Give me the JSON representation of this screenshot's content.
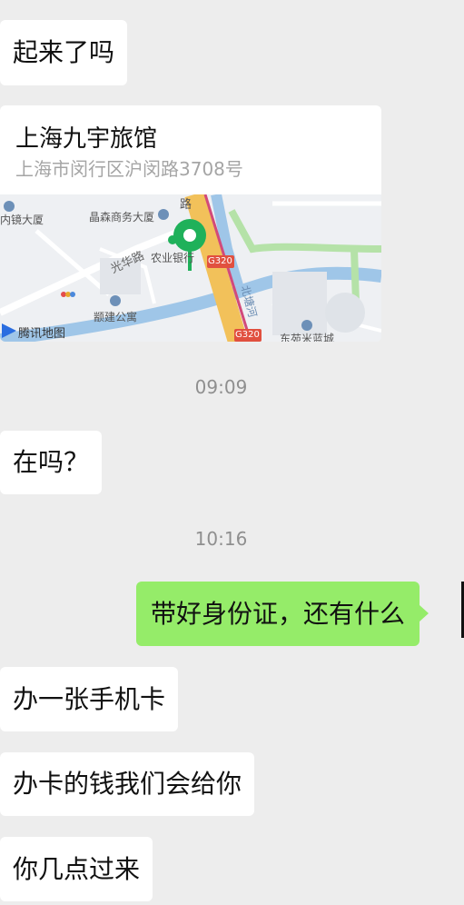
{
  "messages": {
    "m1": "起来了吗",
    "location": {
      "name": "上海九宇旅馆",
      "address": "上海市闵行区沪闵路3708号",
      "map_labels": {
        "neimeng": "内镜大厦",
        "jingsen": "晶森商务大厦",
        "bank": "农业银行",
        "road1": "光华路",
        "apt": "颛建公寓",
        "road2": "路",
        "g320a": "G320",
        "g320b": "G320",
        "river_road": "北塘河",
        "east": "东苑米蓝城",
        "brand": "腾讯地图"
      }
    },
    "time1": "09:09",
    "m2": "在吗？",
    "time2": "10:16",
    "m3": "带好身份证，还有什么",
    "m4": "办一张手机卡",
    "m5": "办卡的钱我们会给你",
    "m6": "你几点过来"
  },
  "colors": {
    "background": "#ededed",
    "incoming_bubble": "#ffffff",
    "outgoing_bubble": "#95ec69",
    "map_pin": "#1fb15a",
    "highway": "#f2c15a",
    "river": "#9fc6e8"
  }
}
